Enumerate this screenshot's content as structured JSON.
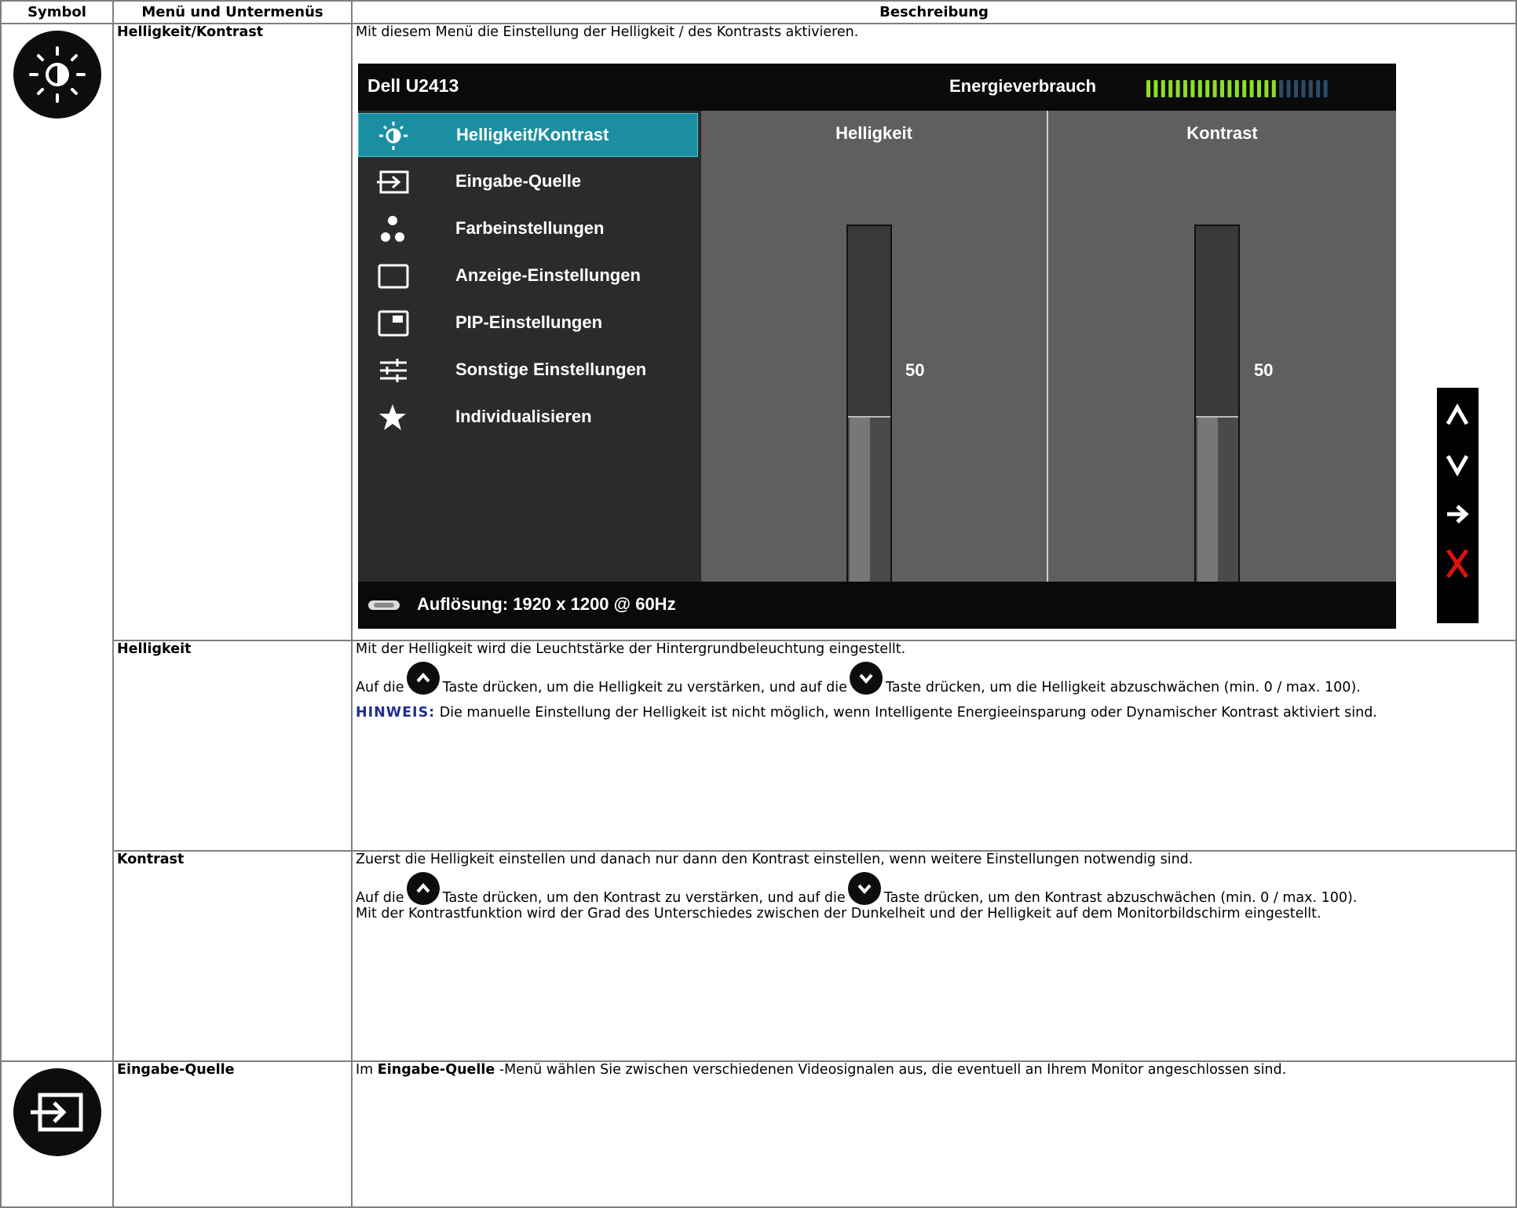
{
  "header": {
    "col1": "Symbol",
    "col2": "Menü und Untermenüs",
    "col3": "Beschreibung"
  },
  "rows": {
    "r1": {
      "menu": "Helligkeit/Kontrast",
      "desc": "Mit diesem Menü die Einstellung der Helligkeit / des Kontrasts aktivieren."
    },
    "r2": {
      "menu": "Helligkeit",
      "p1": "Mit der Helligkeit wird die Leuchtstärke der Hintergrundbeleuchtung eingestellt.",
      "p2a": "Auf die",
      "p2b": "Taste drücken, um die Helligkeit zu verstärken, und auf die",
      "p2c": "Taste drücken, um die Helligkeit abzuschwächen (min. 0 / max. 100).",
      "note_label": "HINWEIS:",
      "note": " Die manuelle Einstellung der Helligkeit ist nicht möglich, wenn Intelligente Energieeinsparung oder Dynamischer Kontrast aktiviert sind."
    },
    "r3": {
      "menu": "Kontrast",
      "p1": "Zuerst die Helligkeit einstellen und danach nur dann den Kontrast einstellen, wenn weitere Einstellungen notwendig sind.",
      "p2a": "Auf die",
      "p2b": "Taste drücken, um den Kontrast zu verstärken, und auf die",
      "p2c": "Taste drücken, um den Kontrast abzuschwächen (min. 0 / max. 100).",
      "p3": "Mit der Kontrastfunktion wird der Grad des Unterschiedes zwischen der Dunkelheit und der Helligkeit auf dem Monitorbildschirm eingestellt."
    },
    "r4": {
      "menu": "Eingabe-Quelle",
      "desc_a": "Im ",
      "desc_b": "Eingabe-Quelle",
      "desc_c": " -Menü wählen Sie zwischen verschiedenen Videosignalen aus, die eventuell an Ihrem Monitor angeschlossen sind."
    }
  },
  "osd": {
    "model": "Dell U2413",
    "energy_label": "Energieverbrauch",
    "energy_level": 0.72,
    "menu_items": [
      {
        "label": "Helligkeit/Kontrast",
        "icon": "brightness-icon"
      },
      {
        "label": "Eingabe-Quelle",
        "icon": "input-source-icon"
      },
      {
        "label": "Farbeinstellungen",
        "icon": "color-dots-icon"
      },
      {
        "label": "Anzeige-Einstellungen",
        "icon": "display-icon"
      },
      {
        "label": "PIP-Einstellungen",
        "icon": "pip-icon"
      },
      {
        "label": "Sonstige Einstellungen",
        "icon": "sliders-icon"
      },
      {
        "label": "Individualisieren",
        "icon": "star-icon"
      }
    ],
    "brightness": {
      "label": "Helligkeit",
      "value": "50"
    },
    "contrast": {
      "label": "Kontrast",
      "value": "50"
    },
    "resolution": "Auflösung: 1920 x 1200 @ 60Hz"
  }
}
